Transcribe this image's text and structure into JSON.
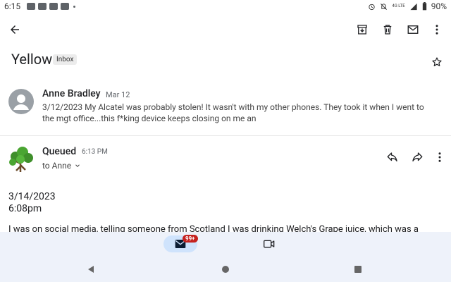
{
  "status_bar": {
    "time": "6:15",
    "battery": "90%",
    "network": "4G LTE"
  },
  "toolbar": {
    "back_icon": "arrow-left-icon",
    "archive_icon": "archive-icon",
    "delete_icon": "trash-icon",
    "mark_unread_icon": "mail-icon",
    "more_icon": "more-vert-icon"
  },
  "thread": {
    "subject": "Yellow",
    "label": "Inbox"
  },
  "message1": {
    "sender": "Anne Bradley",
    "date": "Mar 12",
    "snippet": "3/12/2023 My Alcatel was probably stolen! It wasn't with my other phones. They took it when I went to the mgt office...this f*king device keeps closing on me an"
  },
  "message2": {
    "sender": "Queued",
    "time": "6:13 PM",
    "to": "to Anne",
    "body_date": "3/14/2023",
    "body_time": "6:08pm",
    "body_text": "I was on social media, telling someone from Scotland I was drinking Welch's Grape juice, which was a"
  },
  "bottom_nav": {
    "badge": "99+"
  },
  "colors": {
    "accent_pill": "#cfe3fc",
    "badge": "#c5221f",
    "nav_bg": "#eef2fa"
  }
}
